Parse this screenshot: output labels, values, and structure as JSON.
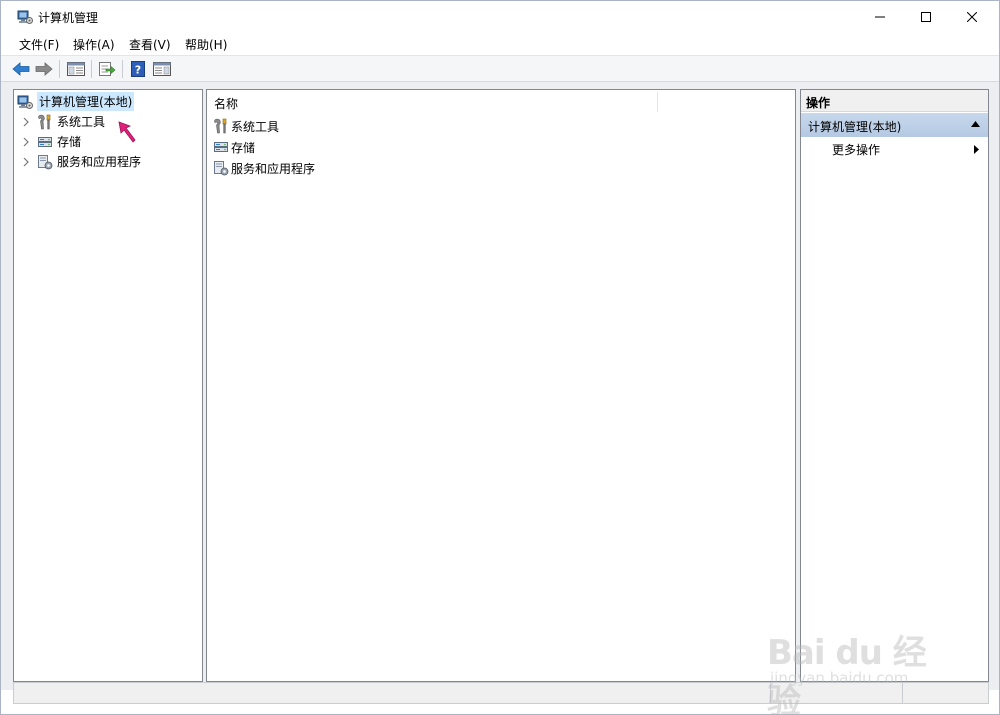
{
  "window": {
    "title": "计算机管理"
  },
  "menu": {
    "file": "文件(F)",
    "action": "操作(A)",
    "view": "查看(V)",
    "help": "帮助(H)"
  },
  "toolbar": {
    "icons": [
      "back-arrow-icon",
      "forward-arrow-icon",
      "show-hide-console-tree-icon",
      "export-list-icon",
      "help-icon",
      "show-hide-action-pane-icon"
    ]
  },
  "tree": {
    "root": "计算机管理(本地)",
    "items": [
      {
        "label": "系统工具",
        "icon": "system-tools-icon"
      },
      {
        "label": "存储",
        "icon": "storage-icon"
      },
      {
        "label": "服务和应用程序",
        "icon": "services-apps-icon"
      }
    ]
  },
  "list": {
    "column_name": "名称",
    "rows": [
      {
        "label": "系统工具"
      },
      {
        "label": "存储"
      },
      {
        "label": "服务和应用程序"
      }
    ]
  },
  "actions": {
    "title": "操作",
    "group": "计算机管理(本地)",
    "more": "更多操作"
  },
  "watermark": {
    "logo": "Bai du 经验",
    "url": "jingyan.baidu.com"
  },
  "colors": {
    "selection": "#cce8ff",
    "actions_header": "#b4c9e3",
    "cursor": "#e0207a"
  }
}
